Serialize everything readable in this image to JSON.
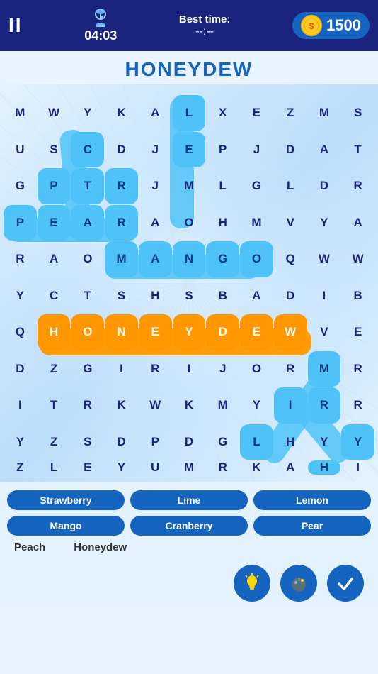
{
  "header": {
    "pause_label": "II",
    "timer": "04:03",
    "best_time_label": "Best time:",
    "best_time_value": "--:--",
    "coins": "1500"
  },
  "game": {
    "title": "HONEYDEW"
  },
  "grid": {
    "rows": [
      [
        "M",
        "W",
        "Y",
        "K",
        "A",
        "L",
        "X",
        "E",
        "Z",
        "M",
        "S"
      ],
      [
        "U",
        "S",
        "C",
        "D",
        "J",
        "E",
        "P",
        "J",
        "D",
        "A",
        "T"
      ],
      [
        "G",
        "P",
        "T",
        "R",
        "J",
        "M",
        "L",
        "G",
        "L",
        "D",
        "R"
      ],
      [
        "P",
        "E",
        "A",
        "R",
        "A",
        "O",
        "H",
        "M",
        "V",
        "Y",
        "A"
      ],
      [
        "R",
        "A",
        "O",
        "M",
        "A",
        "N",
        "G",
        "O",
        "Q",
        "W",
        "W"
      ],
      [
        "Y",
        "C",
        "T",
        "S",
        "H",
        "S",
        "B",
        "A",
        "D",
        "I",
        "B"
      ],
      [
        "Q",
        "H",
        "O",
        "N",
        "E",
        "Y",
        "D",
        "E",
        "W",
        "V",
        "E"
      ],
      [
        "D",
        "Z",
        "G",
        "I",
        "R",
        "I",
        "J",
        "O",
        "R",
        "M",
        "R"
      ],
      [
        "I",
        "T",
        "R",
        "K",
        "W",
        "K",
        "M",
        "Y",
        "I",
        "R",
        "R"
      ],
      [
        "Y",
        "Z",
        "S",
        "D",
        "P",
        "D",
        "G",
        "L",
        "H",
        "Y",
        "Y"
      ],
      [
        "Z",
        "L",
        "E",
        "Y",
        "U",
        "M",
        "R",
        "K",
        "A",
        "H",
        "I"
      ]
    ],
    "highlighted_cells": [
      [
        0,
        5
      ],
      [
        1,
        2
      ],
      [
        1,
        5
      ],
      [
        2,
        1
      ],
      [
        2,
        2
      ],
      [
        2,
        3
      ],
      [
        3,
        0
      ],
      [
        3,
        1
      ],
      [
        3,
        2
      ],
      [
        3,
        3
      ],
      [
        4,
        3
      ],
      [
        4,
        4
      ],
      [
        4,
        5
      ],
      [
        4,
        6
      ],
      [
        4,
        7
      ],
      [
        6,
        1
      ],
      [
        6,
        2
      ],
      [
        6,
        3
      ],
      [
        6,
        4
      ],
      [
        6,
        5
      ],
      [
        6,
        6
      ],
      [
        6,
        7
      ],
      [
        6,
        8
      ],
      [
        7,
        9
      ],
      [
        8,
        8
      ],
      [
        8,
        9
      ],
      [
        9,
        7
      ],
      [
        9,
        10
      ],
      [
        10,
        9
      ]
    ],
    "honeydew_row": 6,
    "honeydew_cols": [
      1,
      2,
      3,
      4,
      5,
      6,
      7,
      8
    ]
  },
  "words": {
    "chips": [
      "Strawberry",
      "Lime",
      "Lemon",
      "Mango",
      "Cranberry",
      "Pear"
    ],
    "plain": [
      "Peach",
      "Honeydew"
    ]
  },
  "actions": {
    "hint_label": "💡",
    "bomb_label": "💣",
    "check_label": "✓"
  },
  "colors": {
    "highlight_blue": "#4fc3f7",
    "honeydew_orange": "#ff9800",
    "chip_bg": "#1565c0",
    "header_bg": "#1a237e",
    "title_color": "#1565c0"
  }
}
